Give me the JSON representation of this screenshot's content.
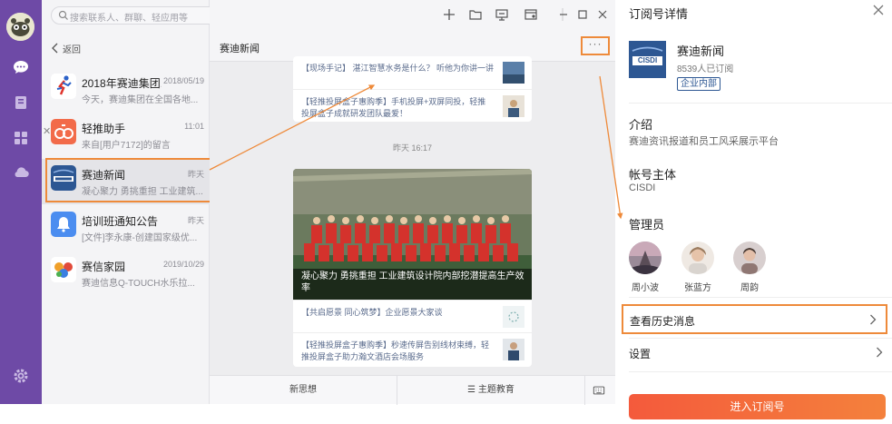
{
  "search": {
    "placeholder": "搜索联系人、群聊、轻应用等"
  },
  "list": {
    "back_label": "返回",
    "items": [
      {
        "name": "2018年赛迪集团...",
        "time": "2018/05/19",
        "preview": "今天，赛迪集团在全国各地...",
        "icon": "runner-icon"
      },
      {
        "name": "轻推助手",
        "time": "11:01",
        "preview": "来自[用户7172]的留言",
        "icon": "assistant-icon"
      },
      {
        "name": "赛迪新闻",
        "time": "昨天",
        "preview": "凝心聚力 勇挑重担 工业建筑...",
        "icon": "cisdi-logo-icon"
      },
      {
        "name": "培训班通知公告",
        "time": "昨天",
        "preview": "[文件]李永康-创建国家级优...",
        "icon": "bell-icon"
      },
      {
        "name": "赛信家园",
        "time": "2019/10/29",
        "preview": "赛迪信息Q-TOUCH水乐拉...",
        "icon": "family-icon"
      }
    ]
  },
  "chat": {
    "title": "赛迪新闻",
    "more_label": "···",
    "top_card": [
      "【现场手记】 湛江智慧水务是什么？ 听他为你讲一讲",
      "【轻推投屏盒子惠购季】手机投屏+双屏同投，轻推投屏盒子成就研发团队最爱！"
    ],
    "timestamp": "昨天 16:17",
    "banner_caption": "凝心聚力 勇挑重担 工业建筑设计院内部挖潜提高生产效率",
    "bottom_card": [
      "【共启愿景 同心筑梦】企业愿景大家谈",
      "【轻推投屏盒子惠购季】秒速传屏告别线材束缚，轻推投屏盒子助力瀚文酒店会场服务"
    ],
    "menu": [
      "新思想",
      "☰ 主题教育"
    ]
  },
  "panel": {
    "title": "订阅号详情",
    "logo_text": "CISDI",
    "name": "赛迪新闻",
    "subscribers": "8539人已订阅",
    "badge": "企业内部",
    "intro_label": "介绍",
    "intro_value": "赛迪资讯报道和员工风采展示平台",
    "owner_label": "帐号主体",
    "owner_value": "CISDI",
    "admins_label": "管理员",
    "admins": [
      "周小波",
      "张蓝方",
      "周韵"
    ],
    "history_label": "查看历史消息",
    "settings_label": "设置",
    "enter_button": "进入订阅号"
  },
  "colors": {
    "rail": "#6e4aa6",
    "highlight": "#ee8a3a",
    "brand": "#2d5793",
    "cta_start": "#f45a3c",
    "cta_end": "#f4813c"
  }
}
